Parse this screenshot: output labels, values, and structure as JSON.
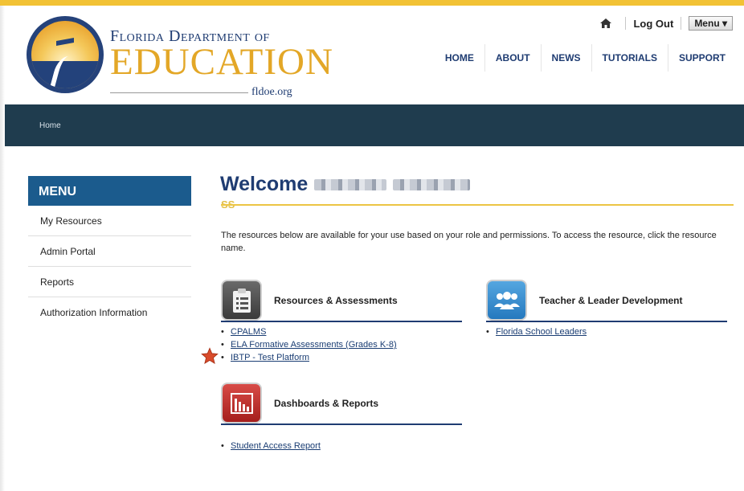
{
  "header": {
    "brand_top": "Florida Department of",
    "brand_main": "EDUCATION",
    "brand_url": "fldoe.org",
    "util": {
      "logout": "Log Out",
      "menu": "Menu ▾"
    },
    "nav": [
      "HOME",
      "ABOUT",
      "NEWS",
      "TUTORIALS",
      "SUPPORT"
    ]
  },
  "breadcrumb": {
    "home": "Home"
  },
  "sidebar": {
    "title": "MENU",
    "items": [
      "My Resources",
      "Admin Portal",
      "Reports",
      "Authorization Information"
    ]
  },
  "main": {
    "welcome": "Welcome",
    "subtag": "SS",
    "intro": "The resources below are available for your use based on your role and permissions. To access the resource, click the resource name.",
    "sections": [
      {
        "title": "Resources & Assessments",
        "links": [
          "CPALMS",
          "ELA Formative Assessments (Grades K-8)",
          "IBTP - Test Platform"
        ]
      },
      {
        "title": "Teacher & Leader Development",
        "links": [
          "Florida School Leaders"
        ]
      },
      {
        "title": "Dashboards & Reports",
        "links": [
          "Student Access Report"
        ]
      }
    ]
  },
  "colors": {
    "navy": "#1f3c72",
    "gold": "#ecc544",
    "band": "#1f3c4e",
    "menu_blue": "#1b5b8d"
  }
}
